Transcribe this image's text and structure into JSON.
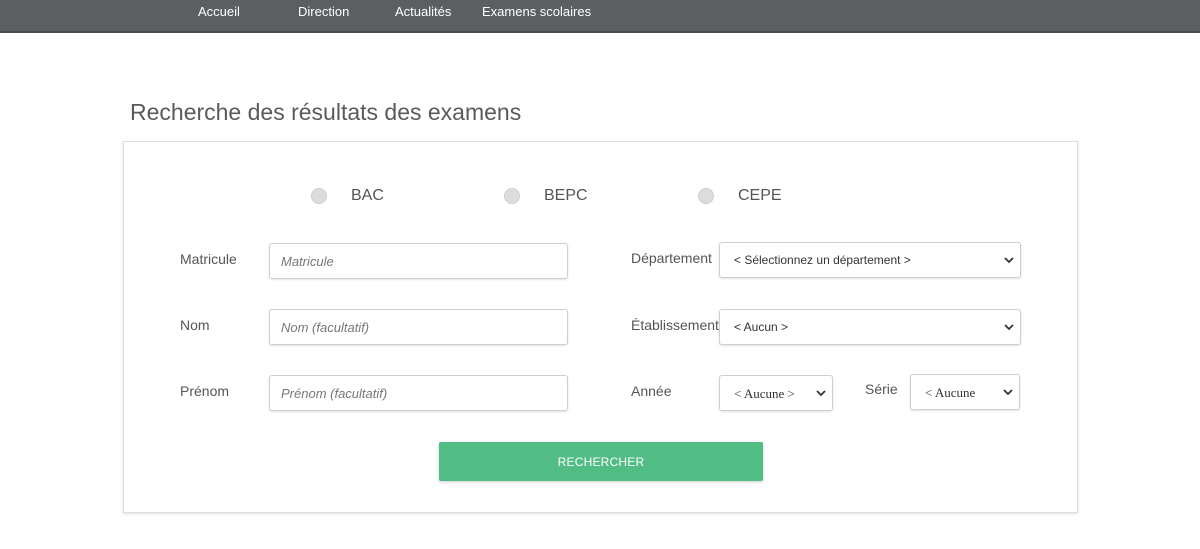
{
  "nav": {
    "items": [
      {
        "label": "Accueil"
      },
      {
        "label": "Direction"
      },
      {
        "label": "Actualités"
      },
      {
        "label": "Examens scolaires"
      }
    ]
  },
  "page": {
    "title": "Recherche des résultats des examens"
  },
  "form": {
    "exam_types": [
      {
        "label": "BAC",
        "checked": false
      },
      {
        "label": "BEPC",
        "checked": false
      },
      {
        "label": "CEPE",
        "checked": false
      }
    ],
    "matricule": {
      "label": "Matricule",
      "placeholder": "Matricule",
      "value": ""
    },
    "nom": {
      "label": "Nom",
      "placeholder": "Nom (facultatif)",
      "value": ""
    },
    "prenom": {
      "label": "Prénom",
      "placeholder": "Prénom (facultatif)",
      "value": ""
    },
    "departement": {
      "label": "Département",
      "selected": "< Sélectionnez un département >"
    },
    "etablissement": {
      "label": "Établissement",
      "selected": "< Aucun >"
    },
    "annee": {
      "label": "Année",
      "selected": "< Aucune >"
    },
    "serie": {
      "label": "Série",
      "selected": "< Aucune"
    },
    "submit_label": "RECHERCHER"
  },
  "icons": {
    "caret": "chevron-down-icon"
  },
  "colors": {
    "topbar": "#5c5f62",
    "button": "#52bc85"
  }
}
